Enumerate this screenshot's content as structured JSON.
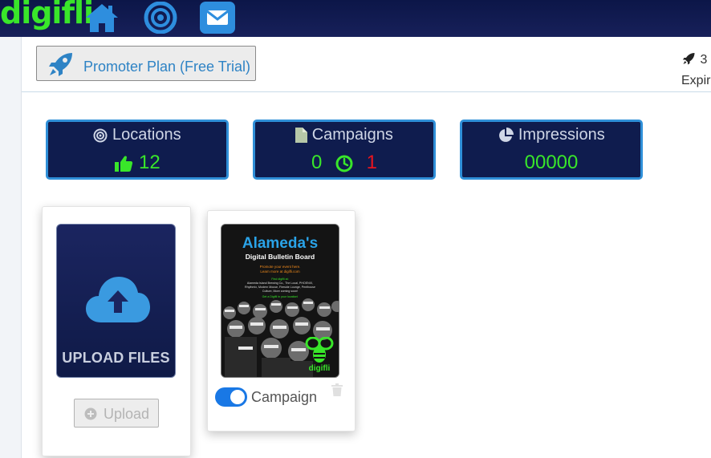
{
  "app": {
    "logo_text": "digifli"
  },
  "nav": {
    "icons": [
      "home-icon",
      "target-icon",
      "mail-icon"
    ]
  },
  "plan": {
    "label": "Promoter Plan (Free Trial)"
  },
  "right_info": {
    "line1": "3",
    "line2": "Expir"
  },
  "stats": {
    "locations": {
      "label": "Locations",
      "value": "12"
    },
    "campaigns": {
      "label": "Campaigns",
      "active": "0",
      "pending": "1"
    },
    "impressions": {
      "label": "Impressions",
      "value": "00000"
    }
  },
  "upload": {
    "tile_label": "UPLOAD FILES",
    "button_label": "Upload"
  },
  "campaign_card": {
    "toggle_on": true,
    "label": "Campaign",
    "poster": {
      "title": "Alameda's",
      "subtitle": "Digital Bulletin Board",
      "line1": "Promote your event here.",
      "line2": "Learn more at digifli.com",
      "line3": "Find digifli at:",
      "line4": "Alameda Island Brewing Co., The Local, PHOENIX,",
      "line5": "Rhythmix, Modern Mouse, Fireside Lounge, Penthouse",
      "line6": "Culture, More coming soon!",
      "line7": "Get a Digifli in your location!",
      "brand": "digifli"
    }
  },
  "colors": {
    "navbar": "#0c1648",
    "accent_blue": "#2f8fd8",
    "green": "#39e62a",
    "red": "#e8141e",
    "toggle_blue": "#1978e5"
  }
}
